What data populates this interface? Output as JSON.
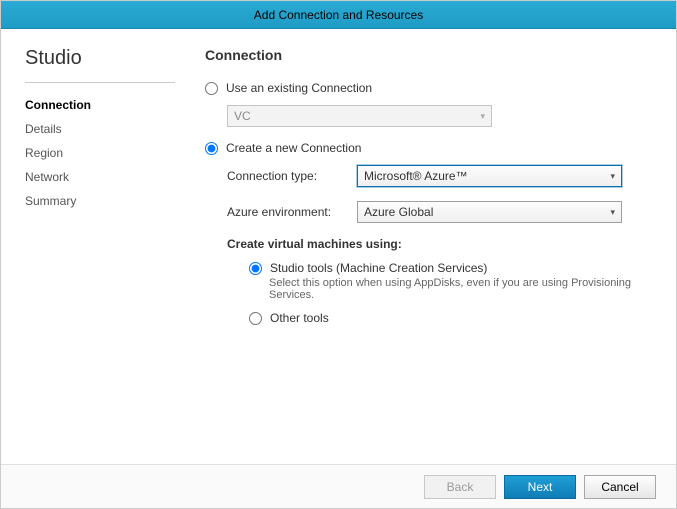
{
  "window": {
    "title": "Add Connection and Resources"
  },
  "sidebar": {
    "brand": "Studio",
    "items": [
      {
        "label": "Connection",
        "active": true
      },
      {
        "label": "Details"
      },
      {
        "label": "Region"
      },
      {
        "label": "Network"
      },
      {
        "label": "Summary"
      }
    ]
  },
  "main": {
    "heading": "Connection",
    "existing_label": "Use an existing Connection",
    "existing_value": "VC",
    "create_label": "Create a new Connection",
    "fields": {
      "type_label": "Connection type:",
      "type_value": "Microsoft® Azure™",
      "env_label": "Azure environment:",
      "env_value": "Azure Global"
    },
    "vm_heading": "Create virtual machines using:",
    "tools": {
      "studio_label": "Studio tools (Machine Creation Services)",
      "studio_desc": "Select this option when using AppDisks, even if you are using Provisioning Services.",
      "other_label": "Other tools"
    }
  },
  "footer": {
    "back": "Back",
    "next": "Next",
    "cancel": "Cancel"
  }
}
